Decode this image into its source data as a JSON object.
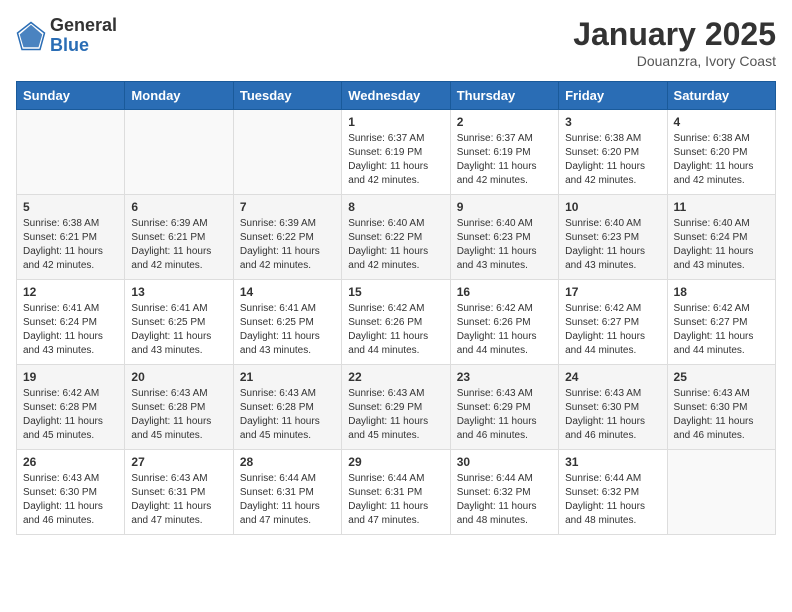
{
  "header": {
    "logo_general": "General",
    "logo_blue": "Blue",
    "title": "January 2025",
    "subtitle": "Douanzra, Ivory Coast"
  },
  "days_of_week": [
    "Sunday",
    "Monday",
    "Tuesday",
    "Wednesday",
    "Thursday",
    "Friday",
    "Saturday"
  ],
  "weeks": [
    [
      {
        "day": "",
        "info": ""
      },
      {
        "day": "",
        "info": ""
      },
      {
        "day": "",
        "info": ""
      },
      {
        "day": "1",
        "info": "Sunrise: 6:37 AM\nSunset: 6:19 PM\nDaylight: 11 hours and 42 minutes."
      },
      {
        "day": "2",
        "info": "Sunrise: 6:37 AM\nSunset: 6:19 PM\nDaylight: 11 hours and 42 minutes."
      },
      {
        "day": "3",
        "info": "Sunrise: 6:38 AM\nSunset: 6:20 PM\nDaylight: 11 hours and 42 minutes."
      },
      {
        "day": "4",
        "info": "Sunrise: 6:38 AM\nSunset: 6:20 PM\nDaylight: 11 hours and 42 minutes."
      }
    ],
    [
      {
        "day": "5",
        "info": "Sunrise: 6:38 AM\nSunset: 6:21 PM\nDaylight: 11 hours and 42 minutes."
      },
      {
        "day": "6",
        "info": "Sunrise: 6:39 AM\nSunset: 6:21 PM\nDaylight: 11 hours and 42 minutes."
      },
      {
        "day": "7",
        "info": "Sunrise: 6:39 AM\nSunset: 6:22 PM\nDaylight: 11 hours and 42 minutes."
      },
      {
        "day": "8",
        "info": "Sunrise: 6:40 AM\nSunset: 6:22 PM\nDaylight: 11 hours and 42 minutes."
      },
      {
        "day": "9",
        "info": "Sunrise: 6:40 AM\nSunset: 6:23 PM\nDaylight: 11 hours and 43 minutes."
      },
      {
        "day": "10",
        "info": "Sunrise: 6:40 AM\nSunset: 6:23 PM\nDaylight: 11 hours and 43 minutes."
      },
      {
        "day": "11",
        "info": "Sunrise: 6:40 AM\nSunset: 6:24 PM\nDaylight: 11 hours and 43 minutes."
      }
    ],
    [
      {
        "day": "12",
        "info": "Sunrise: 6:41 AM\nSunset: 6:24 PM\nDaylight: 11 hours and 43 minutes."
      },
      {
        "day": "13",
        "info": "Sunrise: 6:41 AM\nSunset: 6:25 PM\nDaylight: 11 hours and 43 minutes."
      },
      {
        "day": "14",
        "info": "Sunrise: 6:41 AM\nSunset: 6:25 PM\nDaylight: 11 hours and 43 minutes."
      },
      {
        "day": "15",
        "info": "Sunrise: 6:42 AM\nSunset: 6:26 PM\nDaylight: 11 hours and 44 minutes."
      },
      {
        "day": "16",
        "info": "Sunrise: 6:42 AM\nSunset: 6:26 PM\nDaylight: 11 hours and 44 minutes."
      },
      {
        "day": "17",
        "info": "Sunrise: 6:42 AM\nSunset: 6:27 PM\nDaylight: 11 hours and 44 minutes."
      },
      {
        "day": "18",
        "info": "Sunrise: 6:42 AM\nSunset: 6:27 PM\nDaylight: 11 hours and 44 minutes."
      }
    ],
    [
      {
        "day": "19",
        "info": "Sunrise: 6:42 AM\nSunset: 6:28 PM\nDaylight: 11 hours and 45 minutes."
      },
      {
        "day": "20",
        "info": "Sunrise: 6:43 AM\nSunset: 6:28 PM\nDaylight: 11 hours and 45 minutes."
      },
      {
        "day": "21",
        "info": "Sunrise: 6:43 AM\nSunset: 6:28 PM\nDaylight: 11 hours and 45 minutes."
      },
      {
        "day": "22",
        "info": "Sunrise: 6:43 AM\nSunset: 6:29 PM\nDaylight: 11 hours and 45 minutes."
      },
      {
        "day": "23",
        "info": "Sunrise: 6:43 AM\nSunset: 6:29 PM\nDaylight: 11 hours and 46 minutes."
      },
      {
        "day": "24",
        "info": "Sunrise: 6:43 AM\nSunset: 6:30 PM\nDaylight: 11 hours and 46 minutes."
      },
      {
        "day": "25",
        "info": "Sunrise: 6:43 AM\nSunset: 6:30 PM\nDaylight: 11 hours and 46 minutes."
      }
    ],
    [
      {
        "day": "26",
        "info": "Sunrise: 6:43 AM\nSunset: 6:30 PM\nDaylight: 11 hours and 46 minutes."
      },
      {
        "day": "27",
        "info": "Sunrise: 6:43 AM\nSunset: 6:31 PM\nDaylight: 11 hours and 47 minutes."
      },
      {
        "day": "28",
        "info": "Sunrise: 6:44 AM\nSunset: 6:31 PM\nDaylight: 11 hours and 47 minutes."
      },
      {
        "day": "29",
        "info": "Sunrise: 6:44 AM\nSunset: 6:31 PM\nDaylight: 11 hours and 47 minutes."
      },
      {
        "day": "30",
        "info": "Sunrise: 6:44 AM\nSunset: 6:32 PM\nDaylight: 11 hours and 48 minutes."
      },
      {
        "day": "31",
        "info": "Sunrise: 6:44 AM\nSunset: 6:32 PM\nDaylight: 11 hours and 48 minutes."
      },
      {
        "day": "",
        "info": ""
      }
    ]
  ]
}
